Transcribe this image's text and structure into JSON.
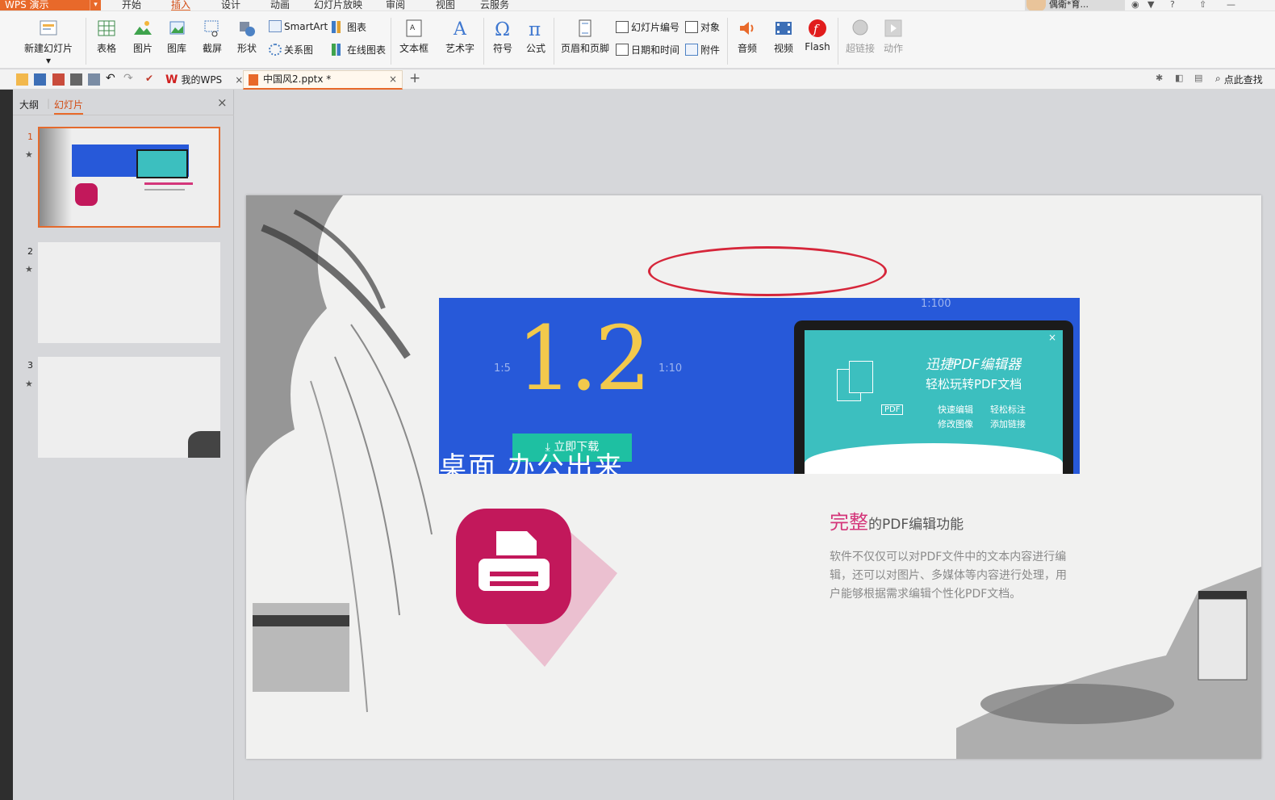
{
  "app": {
    "name": "WPS 演示",
    "menu_arrow": "▾"
  },
  "menu_tabs": [
    "开始",
    "插入",
    "设计",
    "动画",
    "幻灯片放映",
    "审阅",
    "视图",
    "云服务"
  ],
  "active_menu_tab": "插入",
  "user": {
    "name": "偶衛*育..."
  },
  "ribbon": {
    "new_slide": "新建幻灯片",
    "table": "表格",
    "picture": "图片",
    "gallery": "图库",
    "screenshot": "截屏",
    "shape": "形状",
    "smartart": "SmartArt",
    "chart": "图表",
    "relation": "关系图",
    "online_chart": "在线图表",
    "textbox": "文本框",
    "wordart": "艺术字",
    "symbol": "符号",
    "formula": "公式",
    "header_footer": "页眉和页脚",
    "slide_number": "幻灯片编号",
    "object": "对象",
    "date_time": "日期和时间",
    "attachment": "附件",
    "audio": "音频",
    "video": "视频",
    "flash": "Flash",
    "hyperlink": "超链接",
    "action": "动作"
  },
  "tabs": {
    "mywps": "我的WPS",
    "doc": "中国风2.pptx *",
    "close": "×",
    "add": "+",
    "find": "点此查找"
  },
  "panel": {
    "outline_tab": "大纲",
    "slides_tab": "幻灯片",
    "close": "×",
    "slides": [
      {
        "num": "1",
        "selected": true
      },
      {
        "num": "2",
        "selected": false
      },
      {
        "num": "3",
        "selected": false
      }
    ]
  },
  "slide": {
    "banner_version": "1.2",
    "ruler_15": "1:5",
    "ruler_110": "1:10",
    "ruler_1100": "1:100",
    "download_btn": "立即下载",
    "banner_text": "桌面 办公出来",
    "app_title": "迅捷PDF编辑器",
    "app_subtitle": "轻松玩转PDF文档",
    "features": [
      "快速编辑",
      "轻松标注",
      "修改图像",
      "添加链接"
    ],
    "pdf_label": "PDF",
    "headline_highlight": "完整",
    "headline_rest": "的PDF编辑功能",
    "description": "软件不仅仅可以对PDF文件中的文本内容进行编辑，还可以对图片、多媒体等内容进行处理，用户能够根据需求编辑个性化PDF文档。"
  },
  "colors": {
    "accent": "#e8692a",
    "highlight": "#d4367a",
    "banner": "#2759d9",
    "download": "#1ec0a2",
    "oval": "#d6263a"
  }
}
